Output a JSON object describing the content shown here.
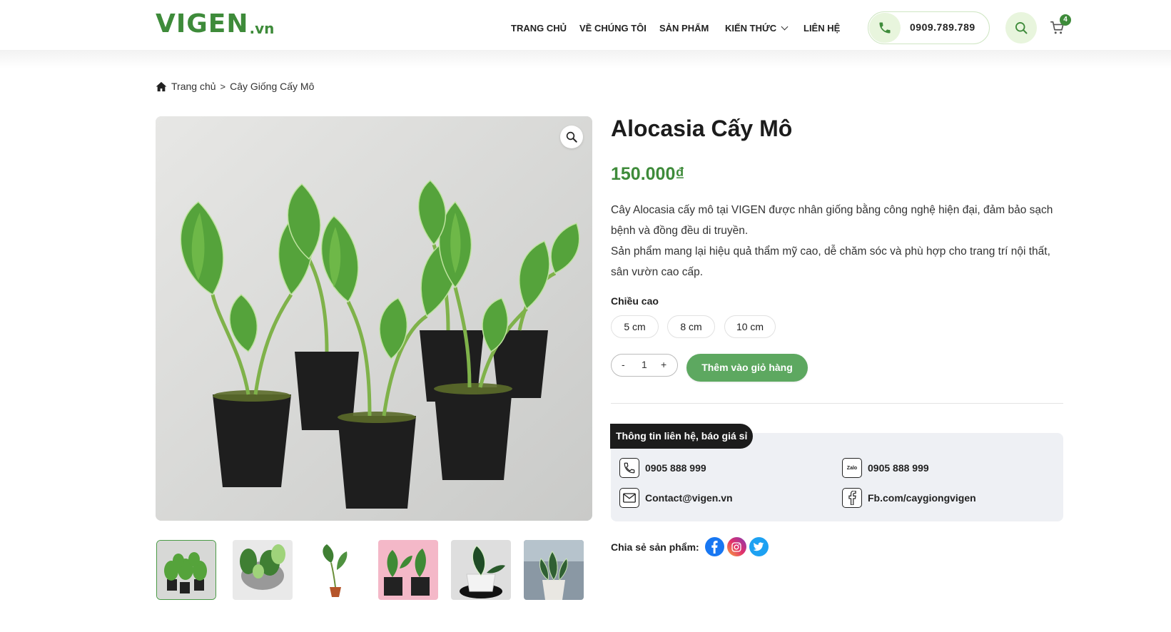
{
  "header": {
    "logo_main": "VIGEN",
    "logo_sub": ".vn",
    "nav": [
      "TRANG CHỦ",
      "VỀ CHÚNG TÔI",
      "SẢN PHẨM",
      "KIẾN THỨC",
      "LIÊN HỆ"
    ],
    "phone": "0909.789.789",
    "cart_count": "4",
    "icons": [
      "phone-icon",
      "search-icon",
      "cart-icon",
      "chevron-down-icon"
    ]
  },
  "breadcrumb": {
    "home": "Trang chủ",
    "separator": ">",
    "current": "Cây Giống Cấy Mô"
  },
  "product": {
    "title": "Alocasia Cấy Mô",
    "price": "150.000₫",
    "description": [
      "Cây Alocasia cấy mô tại VIGEN được nhân giống bằng công nghệ hiện đại, đảm bảo sạch bệnh và đồng đều di truyền.",
      "Sản phẩm mang lại hiệu quả thẩm mỹ cao, dễ chăm sóc và phù hợp cho trang trí nội thất, sân vườn cao cấp."
    ],
    "variant_label": "Chiều cao",
    "variants": [
      "5 cm",
      "8 cm",
      "10 cm"
    ],
    "quantity": "1",
    "qty_minus": "-",
    "qty_plus": "+",
    "add_to_cart": "Thêm vào giỏ hàng",
    "thumbnail_count": 6,
    "active_thumbnail": 0
  },
  "contact": {
    "tab_label": "Thông tin liên hệ, báo giá sỉ",
    "phone": "0905 888 999",
    "zalo": "0905 888 999",
    "zalo_icon_text": "Zalo",
    "email": "Contact@vigen.vn",
    "facebook": "Fb.com/caygiongvigen"
  },
  "share": {
    "label": "Chia sẻ sản phẩm:",
    "networks": [
      "facebook-icon",
      "instagram-icon",
      "twitter-icon"
    ]
  },
  "colors": {
    "brand_green": "#3e8b3a",
    "button_green": "#5da860",
    "light_green": "#e8f5dd",
    "contact_bg": "#eef0f4",
    "dark": "#1c1c1c"
  }
}
